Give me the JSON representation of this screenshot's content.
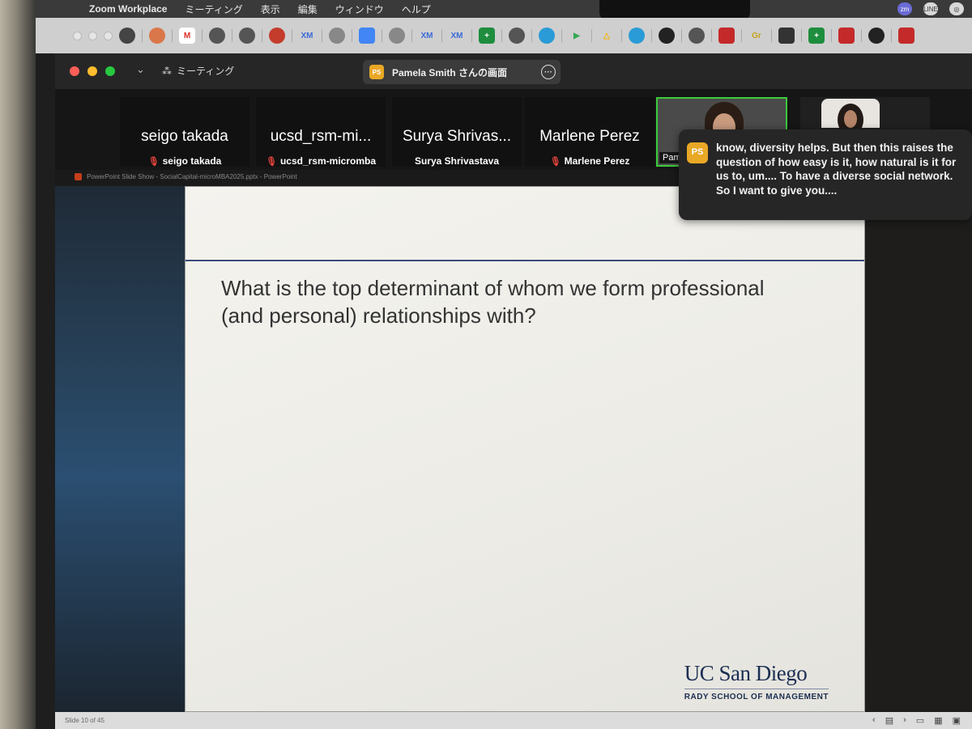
{
  "menubar": {
    "app_name": "Zoom Workplace",
    "items": [
      "ミーティング",
      "表示",
      "編集",
      "ウィンドウ",
      "ヘルプ"
    ],
    "status_icons": [
      "zm",
      "LINE",
      "◎"
    ]
  },
  "tabbar": {
    "icons": [
      "chatgpt",
      "claude",
      "gmail",
      "globe",
      "globe",
      "record",
      "XM",
      "gear",
      "docs",
      "gear",
      "XM",
      "XM",
      "sheets",
      "globe",
      "slack",
      "play",
      "drive",
      "slack",
      "dark",
      "globe",
      "ext",
      "Gr",
      "ext",
      "sheets",
      "ext",
      "github",
      "ext"
    ]
  },
  "zoom": {
    "meeting_label": "ミーティング",
    "share_title": "Pamela Smith さんの画面",
    "ps_initials": "PS"
  },
  "participants": [
    {
      "display": "seigo takada",
      "name": "seigo takada",
      "muted": true
    },
    {
      "display": "ucsd_rsm-mi...",
      "name": "ucsd_rsm-micromba",
      "muted": true
    },
    {
      "display": "Surya Shrivas...",
      "name": "Surya Shrivastava",
      "muted": false
    },
    {
      "display": "Marlene Perez",
      "name": "Marlene Perez",
      "muted": true
    }
  ],
  "video_tile": {
    "name": "Pam"
  },
  "caption": {
    "initials": "PS",
    "text": "know, diversity helps. But then this raises the question of how easy is it, how natural is it for us to, um.... To have a diverse social network. So I want to give you...."
  },
  "powerpoint": {
    "window_title": "PowerPoint Slide Show - SocialCapital-microMBA2025.pptx - PowerPoint",
    "question": "What is the top determinant of whom we form professional (and personal) relationships with?",
    "logo_main": "UC San Diego",
    "logo_sub": "RADY SCHOOL OF MANAGEMENT",
    "slide_counter": "Slide 10 of 45"
  }
}
